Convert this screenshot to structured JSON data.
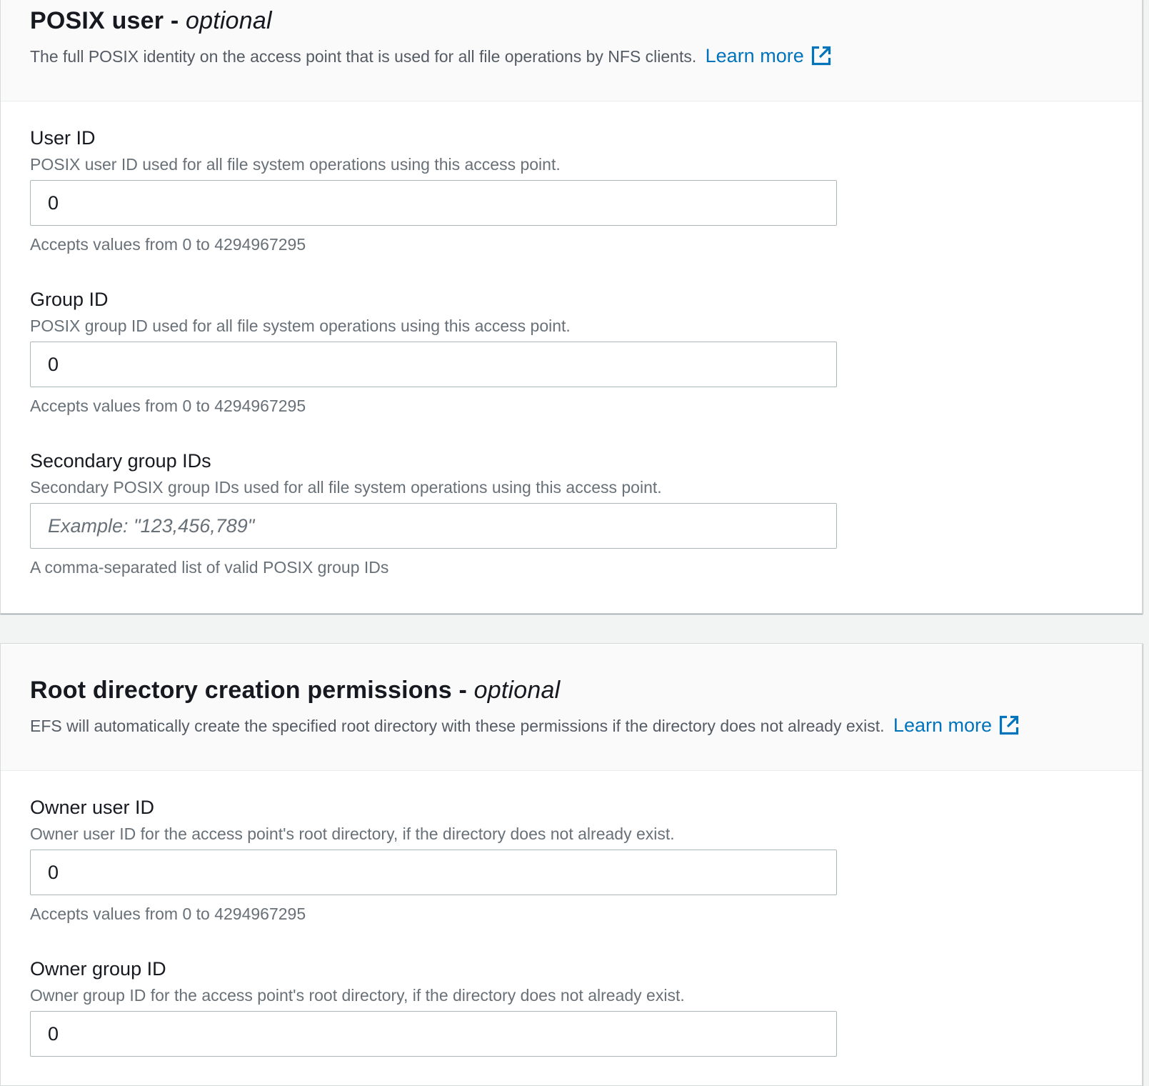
{
  "posix_section": {
    "title": "POSIX user",
    "title_separator": " - ",
    "title_optional": "optional",
    "description": "The full POSIX identity on the access point that is used for all file operations by NFS clients.",
    "learn_more": "Learn more",
    "learn_more_icon": "external-link-icon",
    "fields": {
      "user_id": {
        "label": "User ID",
        "description": "POSIX user ID used for all file system operations using this access point.",
        "value": "0",
        "hint": "Accepts values from 0 to 4294967295"
      },
      "group_id": {
        "label": "Group ID",
        "description": "POSIX group ID used for all file system operations using this access point.",
        "value": "0",
        "hint": "Accepts values from 0 to 4294967295"
      },
      "secondary_group_ids": {
        "label": "Secondary group IDs",
        "description": "Secondary POSIX group IDs used for all file system operations using this access point.",
        "value": "",
        "placeholder": "Example: \"123,456,789\"",
        "hint": "A comma-separated list of valid POSIX group IDs"
      }
    }
  },
  "root_section": {
    "title": "Root directory creation permissions",
    "title_separator": " - ",
    "title_optional": "optional",
    "description": "EFS will automatically create the specified root directory with these permissions if the directory does not already exist.",
    "learn_more": "Learn more",
    "learn_more_icon": "external-link-icon",
    "fields": {
      "owner_user_id": {
        "label": "Owner user ID",
        "description": "Owner user ID for the access point's root directory, if the directory does not already exist.",
        "value": "0",
        "hint": "Accepts values from 0 to 4294967295"
      },
      "owner_group_id": {
        "label": "Owner group ID",
        "description": "Owner group ID for the access point's root directory, if the directory does not already exist.",
        "value": "0"
      }
    }
  },
  "colors": {
    "link": "#0073bb",
    "page_background": "#f2f3f3",
    "panel_header_background": "#fafafa",
    "secondary_text": "#687078",
    "input_border": "#aab7b8"
  }
}
